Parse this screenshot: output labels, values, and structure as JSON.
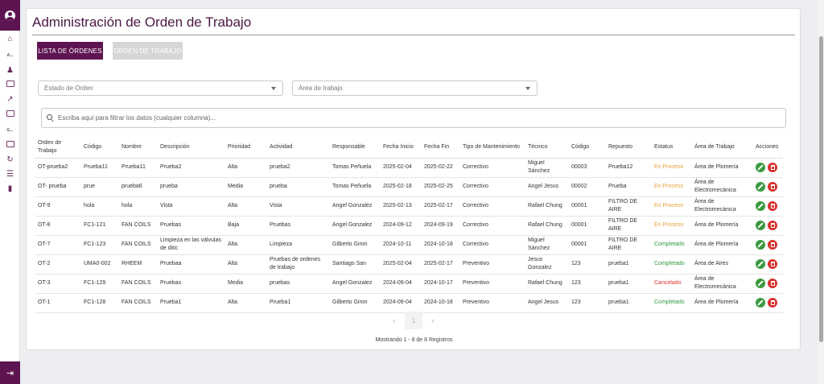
{
  "sidebar": {
    "items": [
      {
        "icon": "home-icon"
      },
      {
        "text": "A..."
      },
      {
        "icon": "user-settings-icon"
      },
      {
        "icon": "card-icon"
      },
      {
        "icon": "chart-icon"
      },
      {
        "icon": "id-card-icon"
      },
      {
        "text": "G..."
      },
      {
        "icon": "calendar-icon"
      },
      {
        "icon": "history-icon"
      },
      {
        "icon": "list-icon"
      },
      {
        "icon": "pin-icon"
      }
    ]
  },
  "page": {
    "title": "Administración de Orden de Trabajo",
    "tabs": {
      "active": "LISTA DE ÓRDENES",
      "inactive": "ORDEN DE TRABAJO"
    },
    "filters": {
      "estado": "Estado de Orden",
      "area": "Area de trabajo"
    },
    "search_placeholder": "Escriba aquí para filtrar los datos (cualquier columna)..."
  },
  "table": {
    "headers": [
      "Orden de Trabajo",
      "Código",
      "Nombre",
      "Descripción",
      "Prioridad",
      "Actividad",
      "Responsable",
      "Fecha Inicio",
      "Fecha Fin",
      "Tipo de Mantenimiento",
      "Técnico",
      "Código",
      "Repuesto",
      "Estatus",
      "Área de Trabajo",
      "Acciones"
    ],
    "rows": [
      [
        "OT-prueba2",
        "Prueba11",
        "Prueba11",
        "Prueba2",
        "Alta",
        "prueba2",
        "Tomas Peñuela",
        "2025-02-04",
        "2025-02-22",
        "Correctivo",
        "Miguel Sánchez",
        "00003",
        "Prueba12",
        "En Proceso",
        "Área de Plomería"
      ],
      [
        "OT- prueba",
        "prue",
        "prueba6",
        "prueba",
        "Media",
        "prueba",
        "Tomas Peñuela",
        "2025-02-18",
        "2025-02-25",
        "Correctivo",
        "Angel Jesus",
        "00002",
        "Prueba",
        "En Proceso",
        "Área de Electromecánica"
      ],
      [
        "OT-9",
        "hola",
        "hola",
        "Vista",
        "Alta",
        "Vista",
        "Angel Gonzalez",
        "2025-02-13",
        "2025-02-17",
        "Correctivo",
        "Rafael Chung",
        "00001",
        "FILTRO DE AIRE",
        "En Proceso",
        "Área de Electromecánica"
      ],
      [
        "OT-8",
        "FC1-121",
        "FAN COILS",
        "Pruebas",
        "Baja",
        "Pruebas",
        "Angel Gonzalez",
        "2024-09-12",
        "2024-09-19",
        "Correctivo",
        "Rafael Chung",
        "00001",
        "FILTRO DE AIRE",
        "En Proceso",
        "Área de Plomería"
      ],
      [
        "OT-7",
        "FC1-123",
        "FAN COILS",
        "Limpieza en las válvulas de ditic",
        "Alta",
        "Limpieza",
        "Gilberto Giron",
        "2024-10-11",
        "2024-10-18",
        "Correctivo",
        "Miguel Sánchez",
        "00001",
        "FILTRO DE AIRE",
        "Completado",
        "Área de Plomería"
      ],
      [
        "OT-2",
        "UMA0-002",
        "RHEEM",
        "Pruebaa",
        "Alta",
        "Pruebas de ordenes de trabajo",
        "Santiago San",
        "2025-02-04",
        "2025-02-17",
        "Preventivo",
        "Jesus Gonzalez",
        "123",
        "prueba1",
        "Completado",
        "Área de Aires"
      ],
      [
        "OT-3",
        "FC1-129",
        "FAN COILS",
        "Pruebas",
        "Media",
        "pruebas",
        "Angel Gonzalez",
        "2024-09-04",
        "2024-10-17",
        "Preventivo",
        "Rafael Chung",
        "123",
        "prueba1",
        "Cancelado",
        "Área de Electromecánica"
      ],
      [
        "OT-1",
        "FC1-128",
        "FAN COILS",
        "Prueba1",
        "Alta",
        "Prueba1",
        "Gilberto Giron",
        "2024-09-04",
        "2024-10-18",
        "Preventivo",
        "Angel Jesus",
        "123",
        "prueba1",
        "Completado",
        "Área de Plomería"
      ]
    ]
  },
  "pagination": {
    "prev": "‹",
    "current": "1",
    "next": "›"
  },
  "footer": "Mostrando 1 - 8 de 8 Registros",
  "colors": {
    "brand": "#5d1451",
    "en_proceso": "#e8a13a",
    "completado": "#2f9a3f",
    "cancelado": "#e0322f"
  }
}
